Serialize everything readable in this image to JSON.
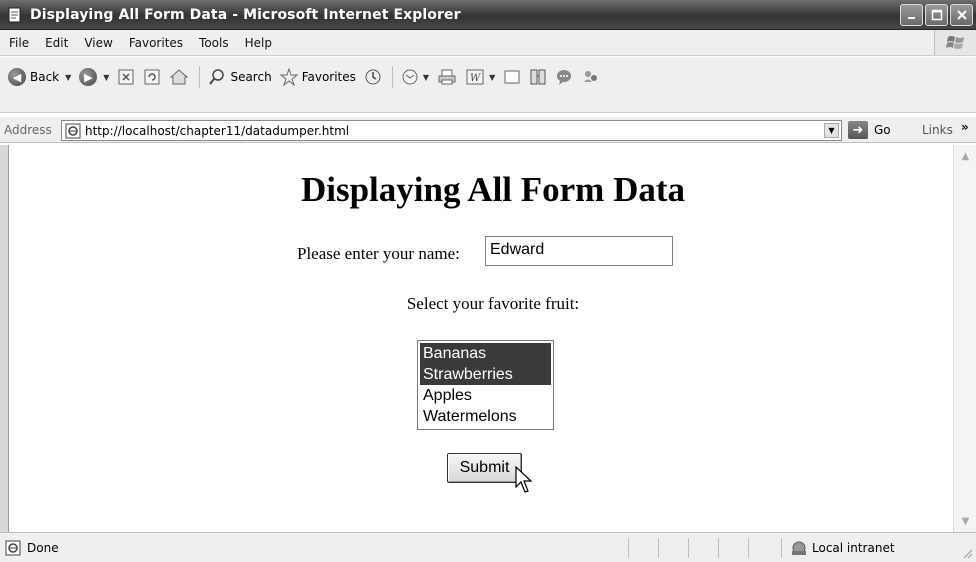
{
  "window": {
    "title": "Displaying All Form Data - Microsoft Internet Explorer"
  },
  "menu": {
    "items": [
      "File",
      "Edit",
      "View",
      "Favorites",
      "Tools",
      "Help"
    ]
  },
  "toolbar": {
    "back_label": "Back",
    "search_label": "Search",
    "favorites_label": "Favorites"
  },
  "address": {
    "label": "Address",
    "url": "http://localhost/chapter11/datadumper.html",
    "go_label": "Go",
    "links_label": "Links",
    "links_chevron": "»"
  },
  "page": {
    "heading": "Displaying All Form Data",
    "name_label": "Please enter your name:",
    "name_value": "Edward",
    "fruit_label": "Select your favorite fruit:",
    "fruits": [
      {
        "label": "Bananas",
        "selected": true
      },
      {
        "label": "Strawberries",
        "selected": true
      },
      {
        "label": "Apples",
        "selected": false
      },
      {
        "label": "Watermelons",
        "selected": false
      }
    ],
    "submit_label": "Submit"
  },
  "status": {
    "text": "Done",
    "zone": "Local intranet"
  }
}
